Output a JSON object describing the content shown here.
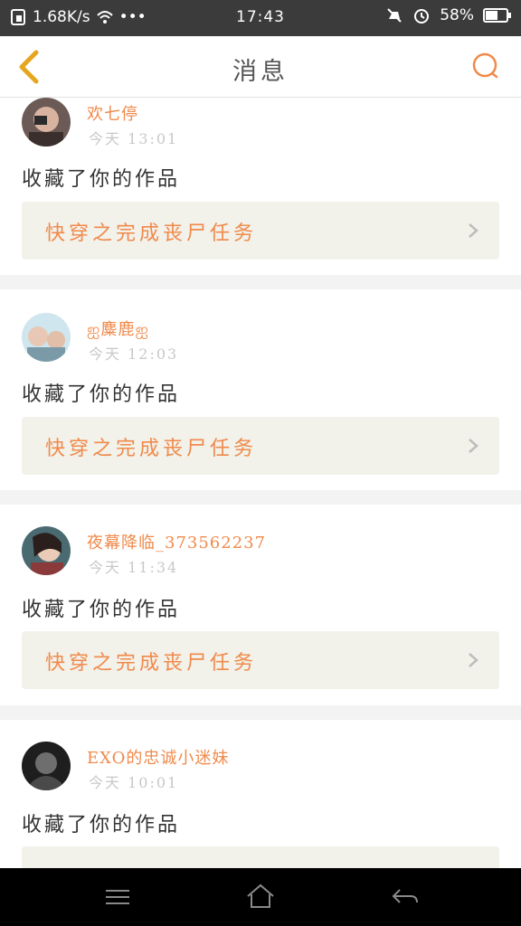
{
  "status_bar": {
    "net_speed": "1.68K/s",
    "dots": "•••",
    "time": "17:43",
    "battery": "58%",
    "icons": [
      "sim-icon",
      "wifi-icon",
      "mute-icon",
      "alarm-icon",
      "battery-icon"
    ]
  },
  "header": {
    "title": "消息",
    "back_icon": "chevron-left-icon",
    "search_icon": "search-icon",
    "accent_color": "#f08a4b"
  },
  "notifications": [
    {
      "user": "欢七停",
      "time": "今天 13:01",
      "message": "收藏了你的作品",
      "work_title": "快穿之完成丧尸任务"
    },
    {
      "user": "ஐ麋鹿ஐ",
      "time": "今天 12:03",
      "message": "收藏了你的作品",
      "work_title": "快穿之完成丧尸任务"
    },
    {
      "user": "夜幕降临_373562237",
      "time": "今天 11:34",
      "message": "收藏了你的作品",
      "work_title": "快穿之完成丧尸任务"
    },
    {
      "user": "EXO的忠诚小迷妹",
      "time": "今天 10:01",
      "message": "收藏了你的作品",
      "work_title": ""
    }
  ],
  "nav_bar": {
    "icons": [
      "menu-icon",
      "home-icon",
      "back-arrow-icon"
    ]
  }
}
